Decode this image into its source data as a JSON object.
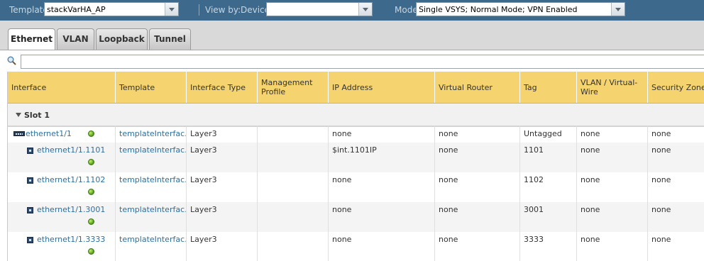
{
  "toolbar": {
    "template_label": "Template",
    "template_value": "stackVarHA_AP",
    "viewby_label": "View by:",
    "device_label": "Device",
    "device_value": "",
    "mode_label": "Mode",
    "mode_value": "Single VSYS; Normal Mode; VPN Enabled"
  },
  "tabs": [
    {
      "label": "Ethernet",
      "active": true
    },
    {
      "label": "VLAN",
      "active": false
    },
    {
      "label": "Loopback",
      "active": false
    },
    {
      "label": "Tunnel",
      "active": false
    }
  ],
  "search": {
    "value": "",
    "placeholder": ""
  },
  "columns": [
    "Interface",
    "Template",
    "Interface Type",
    "Management Profile",
    "IP Address",
    "Virtual Router",
    "Tag",
    "VLAN / Virtual-Wire",
    "Security Zone"
  ],
  "group": {
    "label": "Slot 1"
  },
  "rows": [
    {
      "interface": "ethernet1/1",
      "template": "templateInterfac…",
      "type": "Layer3",
      "mgmt": "",
      "ip": "none",
      "vr": "none",
      "tag": "Untagged",
      "vlan": "none",
      "zone": "none"
    },
    {
      "interface": "ethernet1/1.1101",
      "template": "templateInterfac…",
      "type": "Layer3",
      "mgmt": "",
      "ip": "$int.1101IP",
      "vr": "none",
      "tag": "1101",
      "vlan": "none",
      "zone": "none"
    },
    {
      "interface": "ethernet1/1.1102",
      "template": "templateInterfac…",
      "type": "Layer3",
      "mgmt": "",
      "ip": "none",
      "vr": "none",
      "tag": "1102",
      "vlan": "none",
      "zone": "none"
    },
    {
      "interface": "ethernet1/1.3001",
      "template": "templateInterfac…",
      "type": "Layer3",
      "mgmt": "",
      "ip": "none",
      "vr": "none",
      "tag": "3001",
      "vlan": "none",
      "zone": "none"
    },
    {
      "interface": "ethernet1/1.3333",
      "template": "templateInterfac…",
      "type": "Layer3",
      "mgmt": "",
      "ip": "none",
      "vr": "none",
      "tag": "3333",
      "vlan": "none",
      "zone": "none"
    }
  ],
  "icons": {
    "search": "search-icon",
    "port": "ethernet-port-icon",
    "subinterface": "subinterface-icon",
    "status": "status-up-icon",
    "expand": "expand-triangle-icon",
    "dropdown": "chevron-down-icon"
  },
  "colors": {
    "toolbar_bg": "#3d6a8c",
    "header_bg": "#f5d36e",
    "link": "#2f6f9f",
    "status_up": "#4e9a1e"
  }
}
